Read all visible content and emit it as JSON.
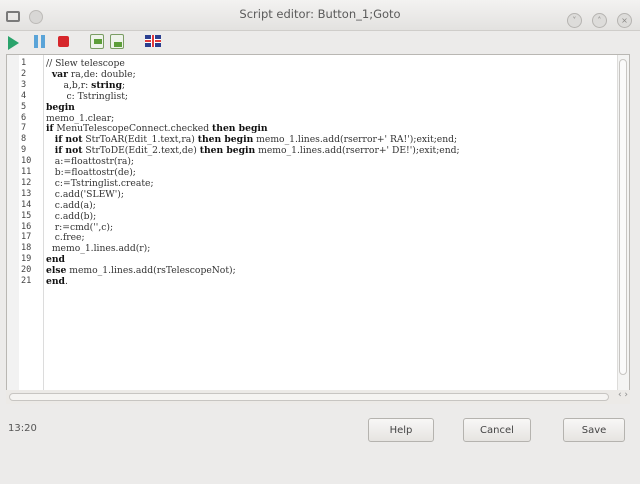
{
  "window": {
    "title": "Script editor: Button_1;Goto"
  },
  "toolbar": {
    "icons": [
      "run-icon",
      "pause-icon",
      "stop-icon",
      "load-icon",
      "save-icon",
      "language-flag-icon"
    ]
  },
  "editor": {
    "lines": [
      {
        "num": "1",
        "html": "// Slew telescope"
      },
      {
        "num": "2",
        "html": "  <b>var</b> ra,de: double;"
      },
      {
        "num": "3",
        "html": "      a,b,r: <b>string</b>;"
      },
      {
        "num": "4",
        "html": "       c: Tstringlist;"
      },
      {
        "num": "5",
        "html": "<b>begin</b>"
      },
      {
        "num": "6",
        "html": "memo_1.clear;"
      },
      {
        "num": "7",
        "html": "<b>if</b> MenuTelescopeConnect.checked <b>then begin</b>"
      },
      {
        "num": "8",
        "html": "   <b>if not</b> StrToAR(Edit_1.text,ra) <b>then begin</b> memo_1.lines.add(rserror+' RA!');exit;end;"
      },
      {
        "num": "9",
        "html": "   <b>if not</b> StrToDE(Edit_2.text,de) <b>then begin</b> memo_1.lines.add(rserror+' DE!');exit;end;"
      },
      {
        "num": "10",
        "html": "   a:=floattostr(ra);"
      },
      {
        "num": "11",
        "html": "   b:=floattostr(de);"
      },
      {
        "num": "12",
        "html": "   c:=Tstringlist.create;"
      },
      {
        "num": "13",
        "html": "   c.add('SLEW');"
      },
      {
        "num": "14",
        "html": "   c.add(a);"
      },
      {
        "num": "15",
        "html": "   c.add(b);"
      },
      {
        "num": "16",
        "html": "   r:=cmd('',c);"
      },
      {
        "num": "17",
        "html": "   c.free;"
      },
      {
        "num": "18",
        "html": "  memo_1.lines.add(r);"
      },
      {
        "num": "19",
        "html": "<b>end</b>"
      },
      {
        "num": "20",
        "html": "<b>else</b> memo_1.lines.add(rsTelescopeNot);"
      },
      {
        "num": "21",
        "html": "<b>end</b>."
      }
    ]
  },
  "status": {
    "cursor": "13:20"
  },
  "buttons": {
    "help": "Help",
    "cancel": "Cancel",
    "save": "Save"
  }
}
